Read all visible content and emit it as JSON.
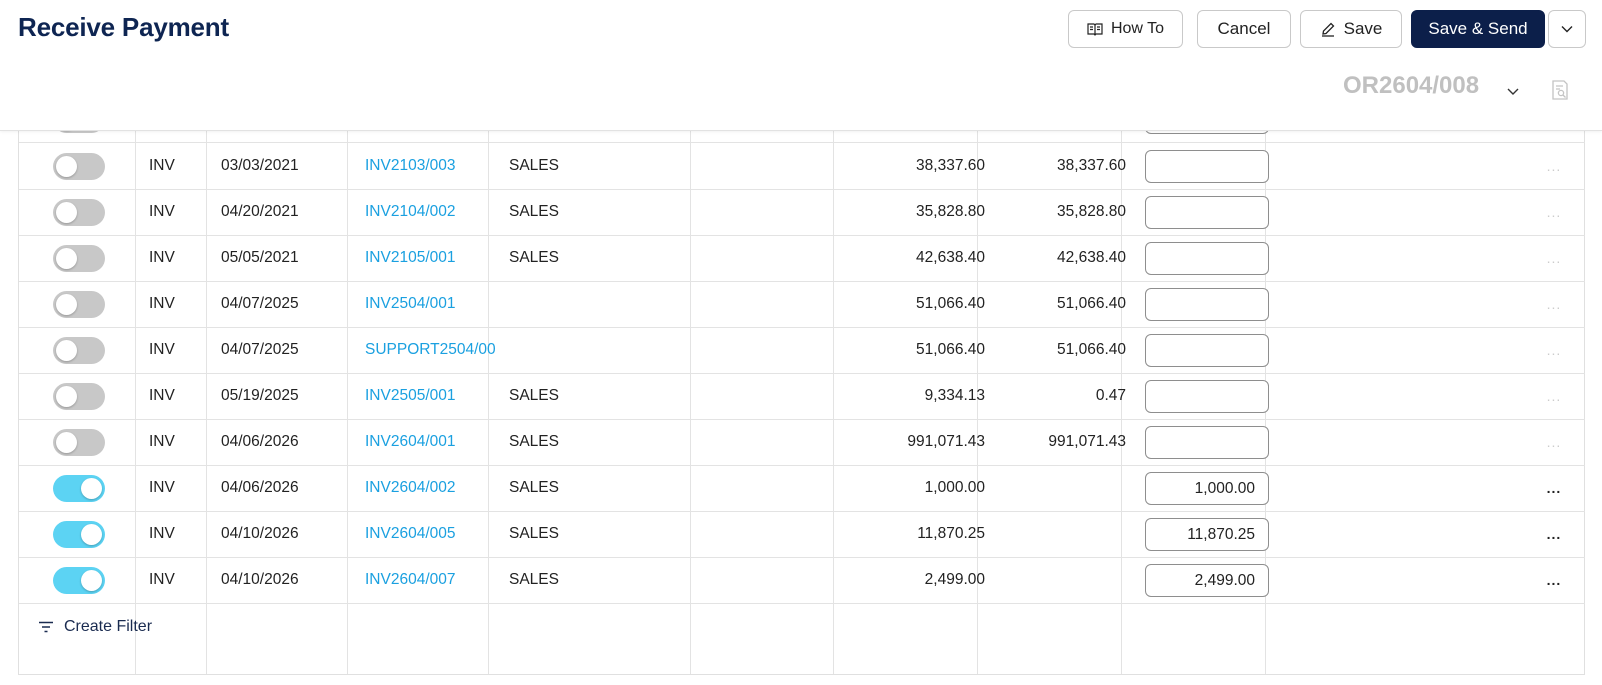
{
  "header": {
    "title": "Receive Payment",
    "how_to_label": "How To",
    "cancel_label": "Cancel",
    "save_label": "Save",
    "save_send_label": "Save & Send",
    "doc_number": "OR2604/008"
  },
  "rows": [
    {
      "on": false,
      "type": "INV",
      "date": "03/03/2021",
      "ref": "INV2103/003",
      "desc": "SALES",
      "amount": "38,337.60",
      "balance": "38,337.60",
      "payment": ""
    },
    {
      "on": false,
      "type": "INV",
      "date": "04/20/2021",
      "ref": "INV2104/002",
      "desc": "SALES",
      "amount": "35,828.80",
      "balance": "35,828.80",
      "payment": ""
    },
    {
      "on": false,
      "type": "INV",
      "date": "05/05/2021",
      "ref": "INV2105/001",
      "desc": "SALES",
      "amount": "42,638.40",
      "balance": "42,638.40",
      "payment": ""
    },
    {
      "on": false,
      "type": "INV",
      "date": "04/07/2025",
      "ref": "INV2504/001",
      "desc": "",
      "amount": "51,066.40",
      "balance": "51,066.40",
      "payment": ""
    },
    {
      "on": false,
      "type": "INV",
      "date": "04/07/2025",
      "ref": "SUPPORT2504/00",
      "desc": "",
      "amount": "51,066.40",
      "balance": "51,066.40",
      "payment": ""
    },
    {
      "on": false,
      "type": "INV",
      "date": "05/19/2025",
      "ref": "INV2505/001",
      "desc": "SALES",
      "amount": "9,334.13",
      "balance": "0.47",
      "payment": ""
    },
    {
      "on": false,
      "type": "INV",
      "date": "04/06/2026",
      "ref": "INV2604/001",
      "desc": "SALES",
      "amount": "991,071.43",
      "balance": "991,071.43",
      "payment": ""
    },
    {
      "on": true,
      "type": "INV",
      "date": "04/06/2026",
      "ref": "INV2604/002",
      "desc": "SALES",
      "amount": "1,000.00",
      "balance": "",
      "payment": "1,000.00"
    },
    {
      "on": true,
      "type": "INV",
      "date": "04/10/2026",
      "ref": "INV2604/005",
      "desc": "SALES",
      "amount": "11,870.25",
      "balance": "",
      "payment": "11,870.25"
    },
    {
      "on": true,
      "type": "INV",
      "date": "04/10/2026",
      "ref": "INV2604/007",
      "desc": "SALES",
      "amount": "2,499.00",
      "balance": "",
      "payment": "2,499.00"
    }
  ],
  "row_menu_glyph": "...",
  "footer": {
    "create_filter_label": "Create Filter"
  },
  "icons": {
    "how_to": "book-icon",
    "save": "pencil-icon",
    "more": "chevron-down-icon",
    "doc_dropdown": "chevron-down-icon",
    "doc_preview": "document-search-icon",
    "filter": "filter-icon"
  },
  "colors": {
    "title": "#0e2552",
    "primary_button": "#0c1f4a",
    "link": "#1aa0e0",
    "toggle_on": "#5cd3f3",
    "toggle_off": "#c8c8c8",
    "doc_number": "#c0c0c0"
  }
}
